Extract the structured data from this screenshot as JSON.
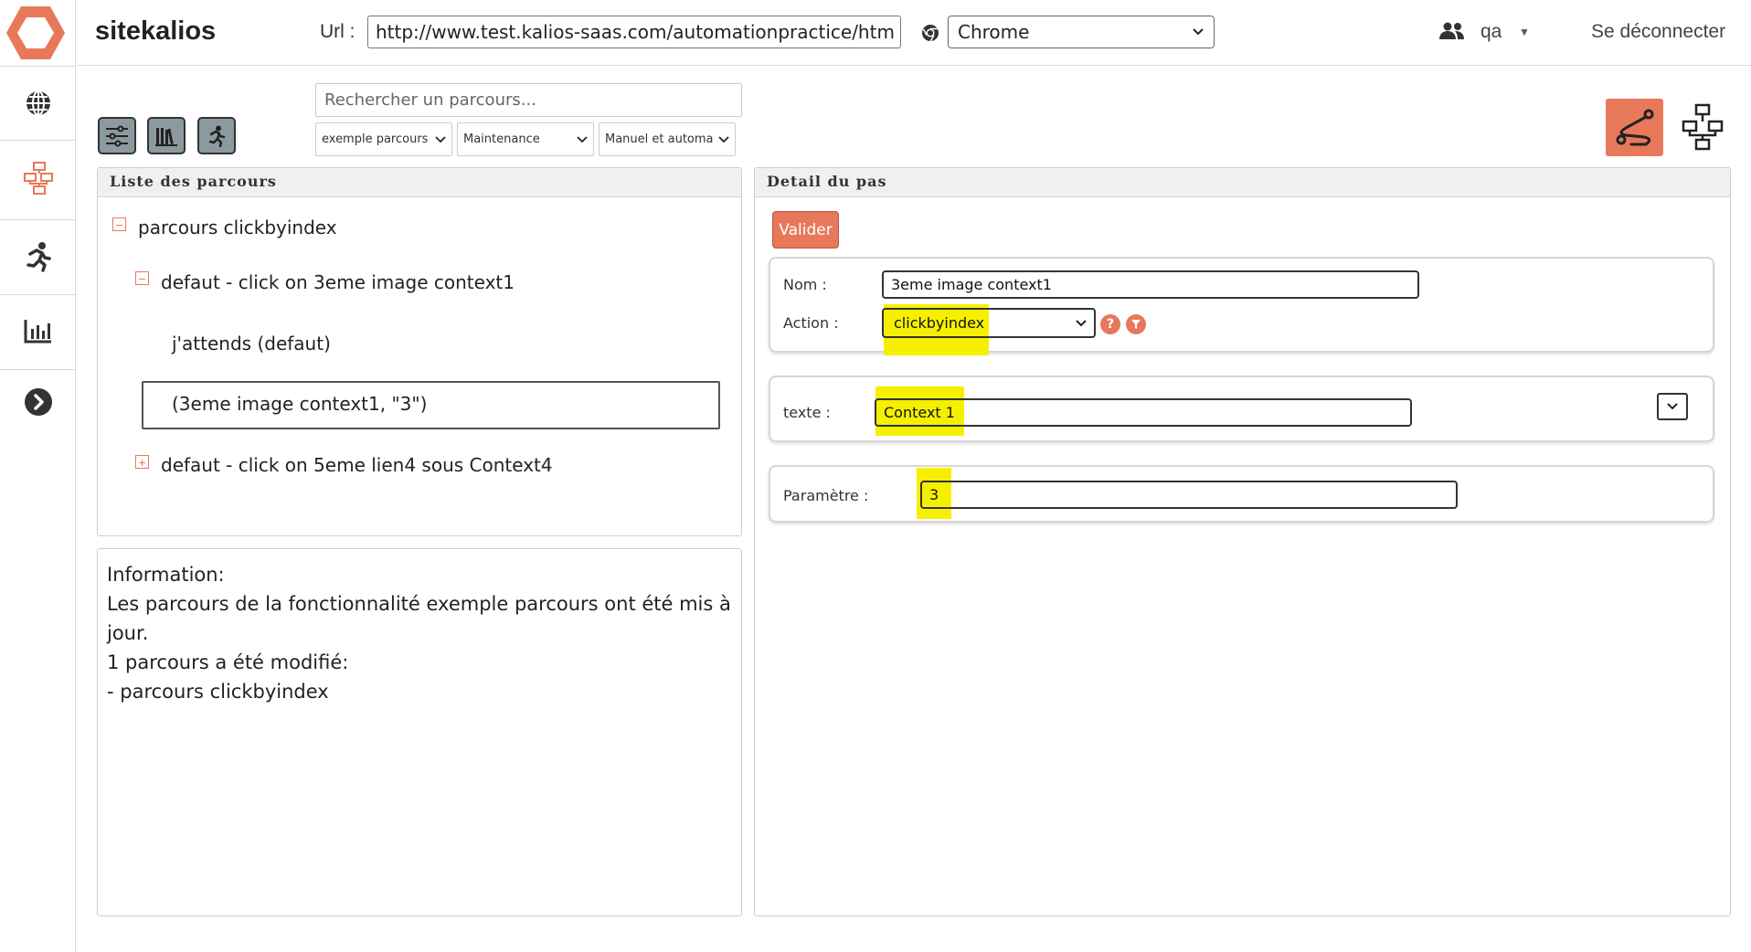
{
  "header": {
    "app_title": "sitekalios",
    "url_label": "Url :",
    "url_value": "http://www.test.kalios-saas.com/automationpractice/htm",
    "browser": "Chrome",
    "user": "qa",
    "logout": "Se déconnecter"
  },
  "sidebar": {
    "items": [
      {
        "icon": "globe-icon"
      },
      {
        "icon": "flowchart-icon",
        "active": true
      },
      {
        "icon": "runner-icon"
      },
      {
        "icon": "bar-chart-icon"
      },
      {
        "icon": "chevron-right-circle-icon"
      }
    ]
  },
  "toolbar": {
    "buttons": [
      "sliders-icon",
      "library-icon",
      "runner-icon"
    ],
    "search_placeholder": "Rechercher un parcours...",
    "filters": [
      "exemple parcours",
      "Maintenance",
      "Manuel et automatis"
    ]
  },
  "list_panel": {
    "title": "Liste des parcours",
    "tree": {
      "root": "parcours clickbyindex",
      "step1": "defaut - click on 3eme image context1",
      "child1": "j'attends (defaut)",
      "child2": "(3eme image context1, \"3\")",
      "step2": "defaut - click on 5eme lien4 sous Context4"
    }
  },
  "info_panel": {
    "title": "Information:",
    "line1": "Les parcours de la fonctionnalité exemple parcours ont été mis à jour.",
    "line2": "1 parcours a été modifié:",
    "line3": "- parcours clickbyindex"
  },
  "detail_panel": {
    "title": "Detail du pas",
    "validate": "Valider",
    "nom_label": "Nom :",
    "nom_value": "3eme image context1",
    "action_label": "Action :",
    "action_value": "clickbyindex",
    "texte_label": "texte :",
    "texte_value": "Context 1",
    "param_label": "Paramètre :",
    "param_value": "3"
  },
  "colors": {
    "accent": "#e8785a",
    "highlight": "#f6f000",
    "tool_button": "#8c9aa0"
  }
}
